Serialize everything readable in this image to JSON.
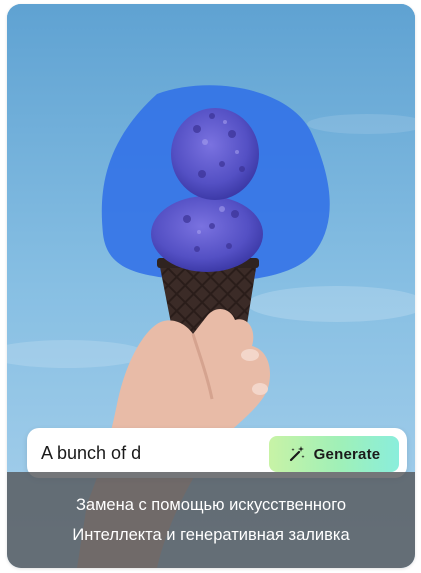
{
  "prompt": {
    "value": "A bunch of d",
    "icon": "magic-wand-icon"
  },
  "generate_button": {
    "label": "Generate",
    "icon": "magic-wand-icon",
    "gradient": [
      "#c8f3a6",
      "#8aeedc"
    ]
  },
  "caption": {
    "line1": "Замена с помощью искусственного",
    "line2": "Интеллекта и генеративная заливка"
  },
  "colors": {
    "sky": "#86bde2",
    "selection_mask": "#2f6ee8",
    "ice_cream": "#5e5bd0",
    "cone": "#3a2a26",
    "caption_bg": "#55585c"
  }
}
